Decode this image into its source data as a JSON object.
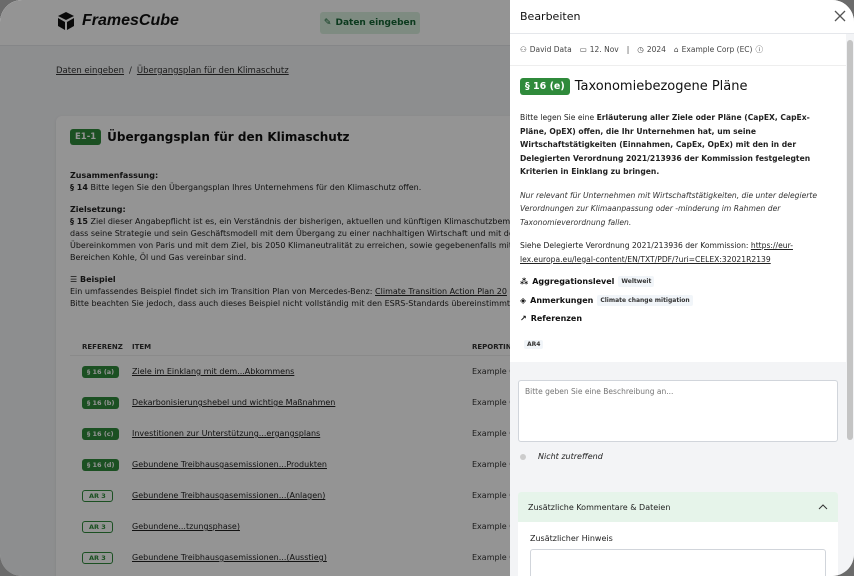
{
  "app": {
    "name": "FramesCube"
  },
  "header": {
    "enter_data_label": "Daten eingeben"
  },
  "breadcrumb": {
    "items": [
      "Daten eingeben",
      "Übergangsplan für den Klimaschutz"
    ],
    "separator": "/"
  },
  "card": {
    "tag": "E1-1",
    "title": "Übergangsplan für den Klimaschutz",
    "summary_heading": "Zusammenfassung:",
    "summary_ref": "§ 14",
    "summary_text": " Bitte legen Sie den Übergangsplan Ihres Unternehmens für den Klimaschutz offen.",
    "goal_heading": "Zielsetzung:",
    "goal_ref": "§ 15",
    "goal_lines": [
      " Ziel dieser Angabepflicht ist es, ein Verständnis der bisherigen, aktuellen und künftigen Klimaschutzbemi",
      "dass seine Strategie und sein Geschäftsmodell mit dem Übergang zu einer nachhaltigen Wirtschaft und mit de",
      "Übereinkommen von Paris und mit dem Ziel, bis 2050 Klimaneutralität zu erreichen, sowie gegebenenfalls mit",
      "Bereichen Kohle, Öl und Gas vereinbar sind."
    ],
    "example_heading": "Beispiel",
    "example_text": "Ein umfassendes Beispiel findet sich im Transition Plan von Mercedes-Benz: ",
    "example_link": "Climate Transition Action Plan 20",
    "example_note": "Bitte beachten Sie jedoch, dass auch dieses Beispiel nicht vollständig mit den ESRS-Standards übereinstimmt",
    "table": {
      "headers": [
        "REFERENZ",
        "ITEM",
        "REPORTING"
      ],
      "rows": [
        {
          "ref": "§ 16 (a)",
          "style": "filled",
          "item": "Ziele im Einklang mit dem...Abkommens",
          "reporting": "Example C"
        },
        {
          "ref": "§ 16 (b)",
          "style": "filled",
          "item": "Dekarbonisierungshebel und wichtige Maßnahmen",
          "reporting": "Example C"
        },
        {
          "ref": "§ 16 (c)",
          "style": "filled",
          "item": "Investitionen zur Unterstützung...ergangsplans",
          "reporting": "Example C"
        },
        {
          "ref": "§ 16 (d)",
          "style": "filled",
          "item": "Gebundene Treibhausgasemissionen...Produkten",
          "reporting": "Example C"
        },
        {
          "ref": "AR 3",
          "style": "outline",
          "item": "Gebundene Treibhausgasemissionen...(Anlagen)",
          "reporting": "Example C"
        },
        {
          "ref": "AR 3",
          "style": "outline",
          "item": "Gebundene...tzungsphase)",
          "reporting": "Example C"
        },
        {
          "ref": "AR 3",
          "style": "outline",
          "item": "Gebundene Treibhausgasemissionen...(Ausstieg)",
          "reporting": "Example C"
        }
      ]
    }
  },
  "drawer": {
    "title": "Bearbeiten",
    "meta": {
      "user": "David Data",
      "date": "12. Nov",
      "separator": "|",
      "year": "2024",
      "company": "Example Corp (EC)"
    },
    "tag": "§ 16 (e)",
    "heading": "Taxonomiebezogene Pläne",
    "p1_pre": "Bitte legen Sie eine ",
    "p1_bold": "Erläuterung aller Ziele oder Pläne (CapEX, CapEx-Pläne, OpEX) offen, die Ihr Unternehmen hat, um seine Wirtschaftstätigkeiten (Einnahmen, CapEx, OpEx) mit den in der Delegierten Verordnung 2021/213936 der Kommission festgelegten Kriterien in Einklang zu bringen.",
    "p2": "Nur relevant für Unternehmen mit Wirtschaftstätigkeiten, die unter delegierte Verordnungen zur Klimaanpassung oder -minderung im Rahmen der Taxonomieverordnung fallen.",
    "p3_pre": "Siehe Delegierte Verordnung 2021/213936 der Kommission: ",
    "p3_link": "https://eur-lex.europa.eu/legal-content/EN/TXT/PDF/?uri=CELEX:32021R2139",
    "aggregation_label": "Aggregationslevel",
    "aggregation_value": "Weltweit",
    "remarks_label": "Anmerkungen",
    "remarks_value": "Climate change mitigation",
    "references_label": "Referenzen",
    "references_value": "AR4",
    "description_placeholder": "Bitte geben Sie eine Beschreibung an...",
    "not_applicable_label": "Nicht zutreffend",
    "accordion_title": "Zusätzliche Kommentare & Dateien",
    "additional_hint_label": "Zusätzlicher Hinweis"
  },
  "colors": {
    "accent_green": "#2f8a3b",
    "light_green": "#e6f4ea"
  }
}
